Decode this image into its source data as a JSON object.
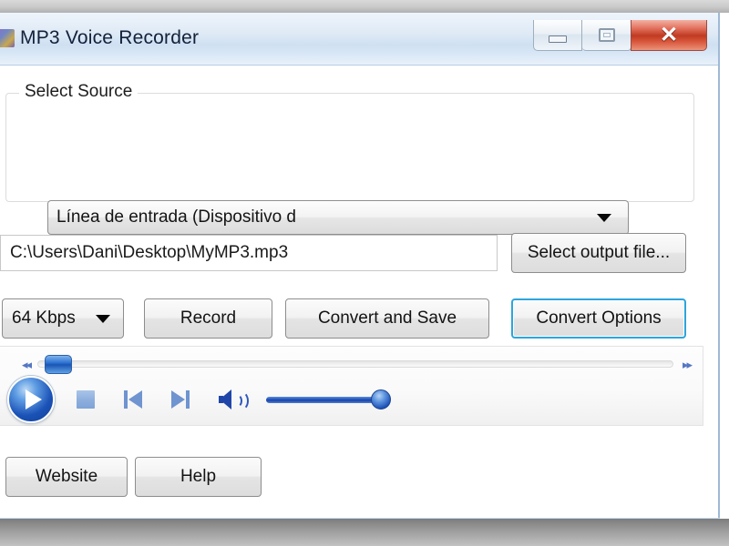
{
  "window": {
    "title": "MP3 Voice Recorder",
    "icon": "app-icon",
    "controls": {
      "minimize_label": "–",
      "maximize_label": "□",
      "close_label": "✕"
    }
  },
  "source_group": {
    "legend": "Select Source",
    "device_combo": {
      "value": "Línea de entrada (Dispositivo d",
      "caret": "chevron-down-icon"
    }
  },
  "output": {
    "path_value": "C:\\Users\\Dani\\Desktop\\MyMP3.mp3",
    "path_placeholder": "C:\\Users\\Dani\\Desktop\\MyMP3.mp3",
    "select_button": "Select output file..."
  },
  "actions": {
    "bitrate_value": "64 Kbps",
    "record_label": "Record",
    "convert_label": "Convert and Save",
    "options_label": "Convert Options",
    "options_focused": true,
    "focus_color": "#2ca5dd"
  },
  "player": {
    "rewind_label": "◂◂",
    "forward_label": "▸▸",
    "seek_percent": 1,
    "volume_percent": 100,
    "icons": {
      "play": "play-icon",
      "stop": "stop-icon",
      "previous": "previous-track-icon",
      "next": "next-track-icon",
      "volume": "volume-icon"
    }
  },
  "footer": {
    "website_label": "Website",
    "help_label": "Help"
  }
}
